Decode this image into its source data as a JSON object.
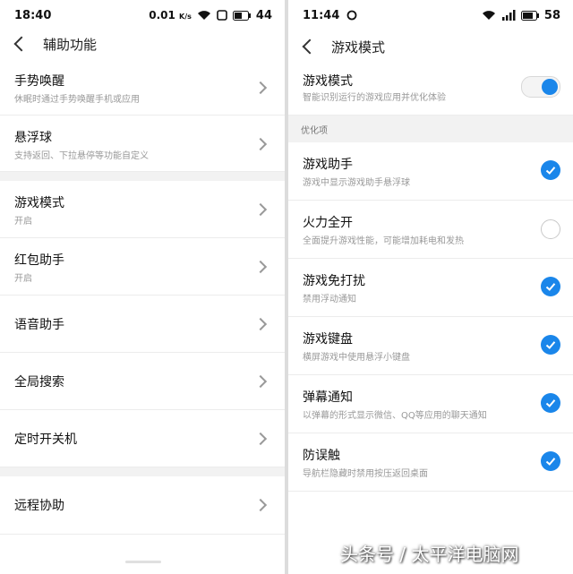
{
  "left": {
    "status": {
      "time": "18:40",
      "speed": "0.01",
      "speed_unit": "K/s",
      "battery": "44"
    },
    "title": "辅助功能",
    "items": [
      {
        "title": "手势唤醒",
        "sub": "休眠时通过手势唤醒手机或应用"
      },
      {
        "title": "悬浮球",
        "sub": "支持返回、下拉悬停等功能自定义"
      },
      {
        "title": "游戏模式",
        "sub": "开启"
      },
      {
        "title": "红包助手",
        "sub": "开启"
      },
      {
        "title": "语音助手",
        "sub": ""
      },
      {
        "title": "全局搜索",
        "sub": ""
      },
      {
        "title": "定时开关机",
        "sub": ""
      },
      {
        "title": "远程协助",
        "sub": ""
      }
    ]
  },
  "right": {
    "status": {
      "time": "11:44",
      "battery": "58"
    },
    "title": "游戏模式",
    "main": {
      "title": "游戏模式",
      "sub": "智能识别运行的游戏应用并优化体验",
      "enabled": true
    },
    "section": "优化项",
    "options": [
      {
        "title": "游戏助手",
        "sub": "游戏中显示游戏助手悬浮球",
        "checked": true
      },
      {
        "title": "火力全开",
        "sub": "全面提升游戏性能，可能增加耗电和发热",
        "checked": false
      },
      {
        "title": "游戏免打扰",
        "sub": "禁用浮动通知",
        "checked": true
      },
      {
        "title": "游戏键盘",
        "sub": "横屏游戏中使用悬浮小键盘",
        "checked": true
      },
      {
        "title": "弹幕通知",
        "sub": "以弹幕的形式显示微信、QQ等应用的聊天通知",
        "checked": true
      },
      {
        "title": "防误触",
        "sub": "导航栏隐藏时禁用按压返回桌面",
        "checked": true
      }
    ]
  },
  "watermark": "头条号 / 太平洋电脑网",
  "accent": "#1a86ea"
}
